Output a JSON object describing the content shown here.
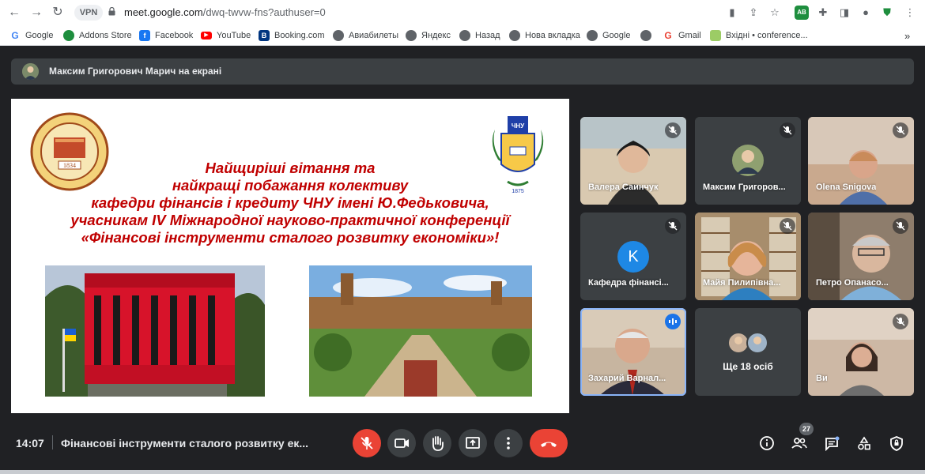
{
  "browser": {
    "url_main": "meet.google.com",
    "url_path": "/dwq-twvw-fns?authuser=0",
    "vpn_label": "VPN",
    "extension_badge": "AB"
  },
  "bookmarks": [
    {
      "label": "Google",
      "icon": "google-icon"
    },
    {
      "label": "Addons Store",
      "icon": "addons-icon"
    },
    {
      "label": "Facebook",
      "icon": "facebook-icon"
    },
    {
      "label": "YouTube",
      "icon": "youtube-icon"
    },
    {
      "label": "Booking.com",
      "icon": "booking-icon"
    },
    {
      "label": "Авиабилеты",
      "icon": "globe-icon"
    },
    {
      "label": "Яндекс",
      "icon": "globe-icon"
    },
    {
      "label": "Назад",
      "icon": "globe-icon"
    },
    {
      "label": "Нова вкладка",
      "icon": "globe-icon"
    },
    {
      "label": "Google",
      "icon": "globe-icon"
    },
    {
      "label": "",
      "icon": "globe-icon"
    },
    {
      "label": "Gmail",
      "icon": "gmail-icon"
    },
    {
      "label": "Вхідні • conference...",
      "icon": "inbox-icon"
    }
  ],
  "presenter": {
    "label": "Максим Григорович Марич на екрані"
  },
  "slide": {
    "lines": [
      "Найщиріші вітання та",
      "найкращі побажання колективу",
      "кафедри фінансів і кредиту ЧНУ імені Ю.Федьковича,",
      "учасникам IV Міжнародної науково-практичної конференції",
      "«Фінансові інструменти сталого розвитку економіки»!"
    ],
    "seal1_year": "1834",
    "seal2_abbr": "ЧНУ",
    "seal2_year": "1875",
    "text_color": "#c00000"
  },
  "participants": [
    {
      "name": "Валера Саинчук",
      "muted": true
    },
    {
      "name": "Максим Григоров...",
      "muted": true
    },
    {
      "name": "Olena Snigova",
      "muted": true
    },
    {
      "name": "Кафедра фінансі...",
      "muted": true,
      "initial": "K"
    },
    {
      "name": "Майя Пилипівна...",
      "muted": true
    },
    {
      "name": "Петро Опанасо...",
      "muted": true
    },
    {
      "name": "Захарий Варнал...",
      "muted": false,
      "speaking": true
    },
    {
      "name": "Ще 18 осіб",
      "muted": false
    },
    {
      "name": "Ви",
      "muted": true
    }
  ],
  "footer": {
    "time": "14:07",
    "meeting_title": "Фінансові інструменти сталого розвитку ек...",
    "people_count": "27"
  },
  "colors": {
    "meet_bg": "#202124",
    "end_call": "#ea4335",
    "speaking": "#8ab4f8"
  }
}
